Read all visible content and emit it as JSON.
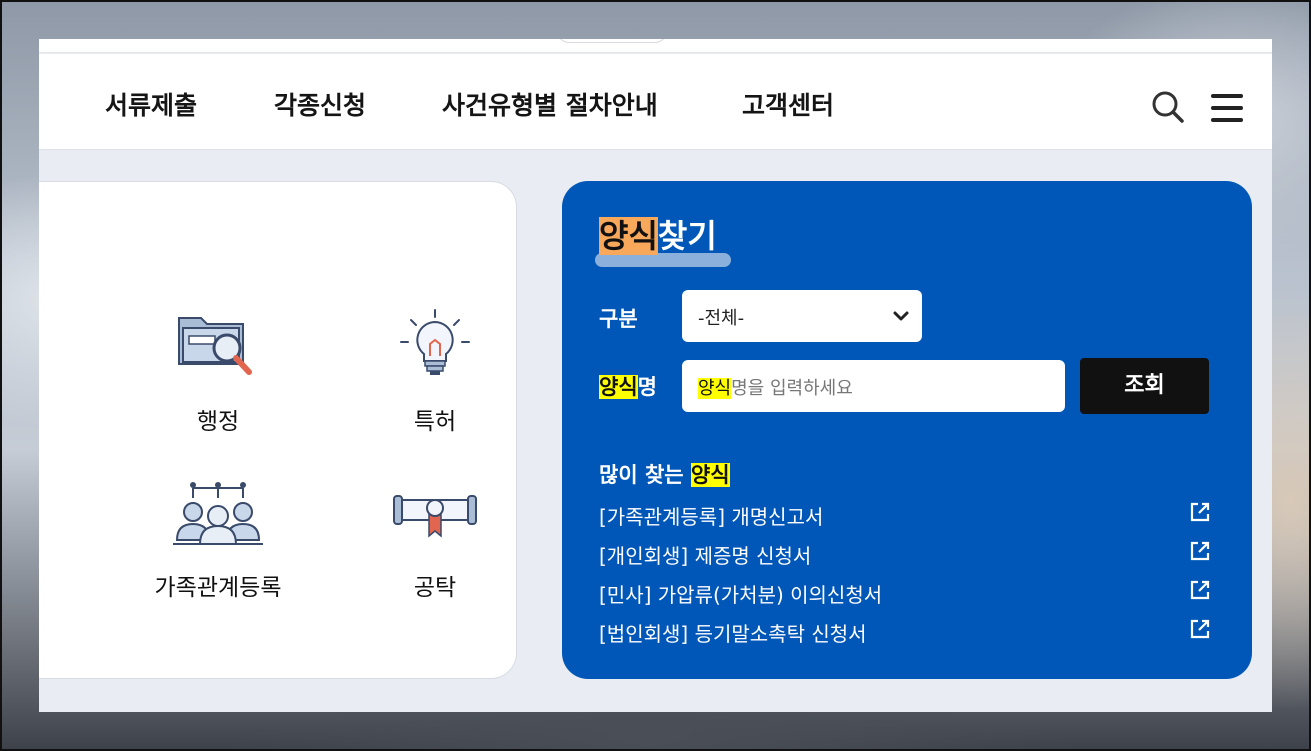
{
  "nav": {
    "items": [
      "서류제출",
      "각종신청",
      "사건유형별 절차안내",
      "고객센터"
    ]
  },
  "categories": [
    {
      "label": "행정",
      "icon": "folder-search-icon"
    },
    {
      "label": "특허",
      "icon": "lightbulb-icon"
    },
    {
      "label": "가족관계등록",
      "icon": "family-group-icon"
    },
    {
      "label": "공탁",
      "icon": "certificate-scroll-icon"
    }
  ],
  "form_search": {
    "title_highlight": "양식",
    "title_rest": "찾기",
    "category_label": "구분",
    "category_selected": "-전체-",
    "name_label_highlight": "양식",
    "name_label_rest": "명",
    "input_placeholder_highlight": "양식",
    "input_placeholder_rest": "명을 입력하세요",
    "submit_label": "조회",
    "popular_title_prefix": "많이 찾는 ",
    "popular_title_highlight": "양식",
    "popular_items": [
      "[가족관계등록] 개명신고서",
      "[개인회생] 제증명 신청서",
      "[민사] 가압류(가처분) 이의신청서",
      "[법인회생] 등기말소촉탁 신청서"
    ]
  },
  "colors": {
    "brand_blue": "#0057b8",
    "highlight_orange": "#f7a85a",
    "highlight_yellow": "#ffff00",
    "button_dark": "#111111"
  }
}
